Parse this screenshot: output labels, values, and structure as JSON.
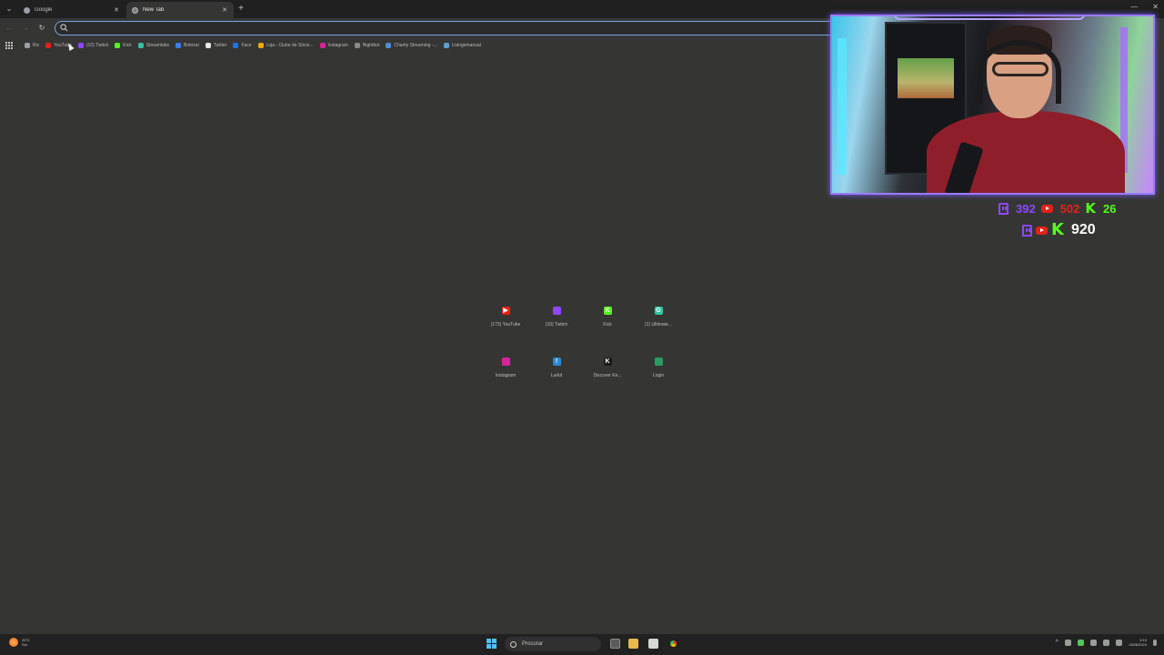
{
  "browser": {
    "tabs": [
      {
        "label": "Google",
        "active": false
      },
      {
        "label": "New Tab",
        "active": true
      }
    ],
    "new_tab_label": "+",
    "omnibox": {
      "value": "",
      "placeholder": ""
    }
  },
  "bookmarks": [
    {
      "label": "Ric",
      "color": "#9aa0a6"
    },
    {
      "label": "YouTube",
      "color": "#e62117"
    },
    {
      "label": "(10) Twitch",
      "color": "#9146ff"
    },
    {
      "label": "Kick",
      "color": "#53fc18"
    },
    {
      "label": "Streamlabs",
      "color": "#31c3a2"
    },
    {
      "label": "Botrixai",
      "color": "#3d7ee6"
    },
    {
      "label": "Twitter",
      "color": "#e7e9e5"
    },
    {
      "label": "Face",
      "color": "#1877f2"
    },
    {
      "label": "Loja - Clube de Sócio...",
      "color": "#f2a900"
    },
    {
      "label": "Instagram",
      "color": "#d6249f"
    },
    {
      "label": "Nightbot",
      "color": "#8a8d89"
    },
    {
      "label": "Charity Streaming -...",
      "color": "#4a90e2"
    },
    {
      "label": "Livingemanual",
      "color": "#5aa0d8"
    }
  ],
  "shortcuts": [
    {
      "label": "(173) YouTube",
      "color": "#e62117",
      "glyph": "▶"
    },
    {
      "label": "(10) Twitch",
      "color": "#9146ff",
      "glyph": ""
    },
    {
      "label": "Kick",
      "color": "#53fc18",
      "glyph": "K"
    },
    {
      "label": "(1) Ultimate...",
      "color": "#31c3a2",
      "glyph": "G"
    },
    {
      "label": "Instagram",
      "color": "#d6249f",
      "glyph": ""
    },
    {
      "label": "Lurkit",
      "color": "#2d8ad1",
      "glyph": "!"
    },
    {
      "label": "Discover Ke...",
      "color": "#1b1b1d",
      "glyph": "K"
    },
    {
      "label": "Login",
      "color": "#2e9a63",
      "glyph": ""
    }
  ],
  "stats": {
    "twitch": "392",
    "youtube": "502",
    "kick": "26",
    "total": "920",
    "colors": {
      "twitch": "#9146ff",
      "youtube": "#e62117",
      "kick": "#53fc18"
    }
  },
  "taskbar": {
    "weather_temp": "20°C",
    "weather_desc": "Sol",
    "search_placeholder": "Procurar",
    "time": "3:10",
    "date": "13/06/2024"
  }
}
